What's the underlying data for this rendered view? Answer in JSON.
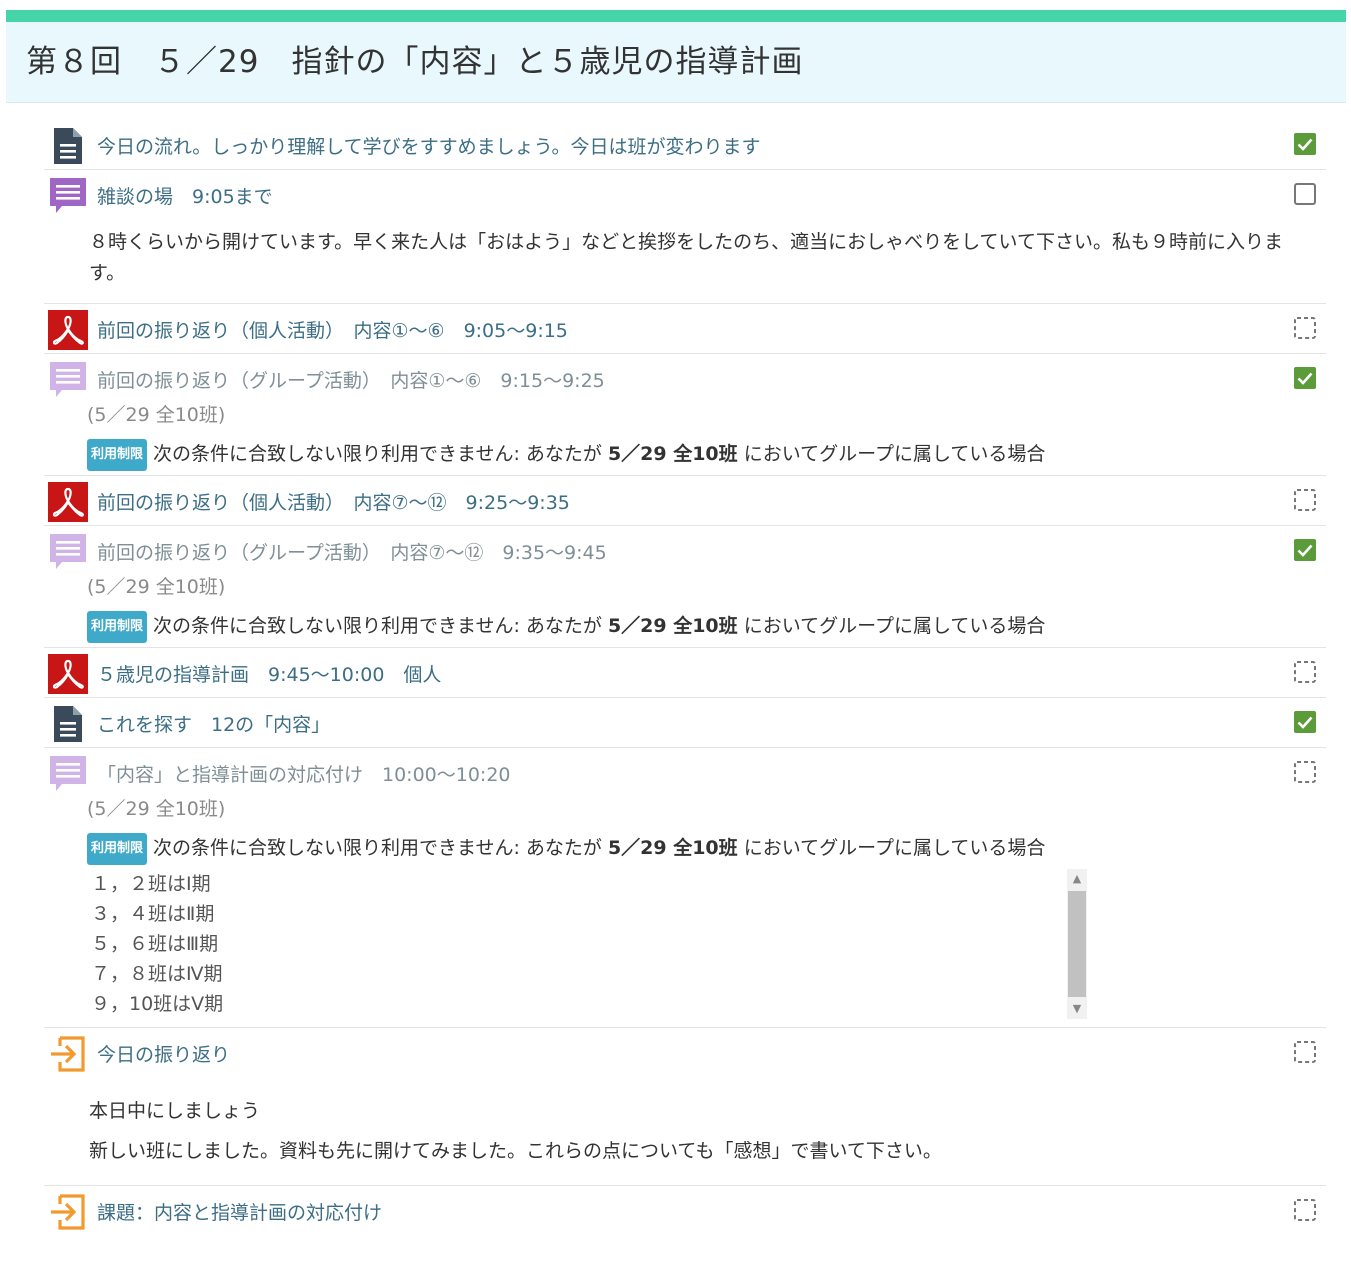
{
  "section": {
    "title": "第８回　５／29　指針の「内容」と５歳児の指導計画"
  },
  "restriction": {
    "badge": "利用制限",
    "prefix": "次の条件に合致しない限り利用できません: あなたが ",
    "group": "5／29 全10班",
    "suffix": " においてグループに属している場合"
  },
  "activities": [
    {
      "icon": "page-icon",
      "name": "今日の流れ。しっかり理解して学びをすすめましょう。今日は班が変わります",
      "completion": "complete"
    },
    {
      "icon": "forum-icon",
      "name": "雑談の場　9:05まで",
      "completion": "incomplete",
      "description": [
        "８時くらいから開けています。早く来た人は「おはよう」などと挨拶をしたのち、適当におしゃべりをしていて下さい。私も９時前に入ります。"
      ]
    },
    {
      "icon": "pdf-icon",
      "name": "前回の振り返り（個人活動）　内容①～⑥　9:05～9:15",
      "completion": "auto"
    },
    {
      "icon": "forum-icon",
      "name": "前回の振り返り（グループ活動）　内容①～⑥　9:15～9:25",
      "completion": "complete",
      "group_note": "(5／29 全10班)"
    },
    {
      "icon": "pdf-icon",
      "name": "前回の振り返り（個人活動）　内容⑦～⑫　9:25～9:35",
      "completion": "auto"
    },
    {
      "icon": "forum-icon",
      "name": "前回の振り返り（グループ活動）　内容⑦～⑫　9:35～9:45",
      "completion": "complete",
      "group_note": "(5／29 全10班)"
    },
    {
      "icon": "pdf-icon",
      "name": "５歳児の指導計画　9:45～10:00　個人",
      "completion": "auto"
    },
    {
      "icon": "page-icon",
      "name": "これを探す　12の「内容」",
      "completion": "complete"
    },
    {
      "icon": "forum-icon",
      "name": "「内容」と指導計画の対応付け　10:00～10:20",
      "completion": "auto",
      "group_note": "(5／29 全10班)",
      "lines": [
        "１，２班はⅠ期",
        "３，４班はⅡ期",
        "５，６班はⅢ期",
        "７，８班はⅣ期",
        "９，10班はⅤ期"
      ]
    },
    {
      "icon": "assignment-icon",
      "name": "今日の振り返り",
      "completion": "auto",
      "description": [
        "本日中にしましょう",
        "新しい班にしました。資料も先に開けてみました。これらの点についても「感想」で書いて下さい。"
      ]
    },
    {
      "icon": "assignment-icon",
      "name": "課題：内容と指導計画の対応付け",
      "completion": "auto"
    }
  ],
  "colors": {
    "accent": "#46d5a8",
    "header_bg": "#e9f8fd",
    "link": "#3c6e85",
    "page_icon": "#3a4a5a",
    "forum_icon": "#a066c6",
    "forum_icon_dim": "#d0b4e8",
    "pdf_icon": "#c81515",
    "assignment_icon": "#f29930",
    "check_green": "#5b9b3a",
    "badge": "#3fa9c9"
  }
}
